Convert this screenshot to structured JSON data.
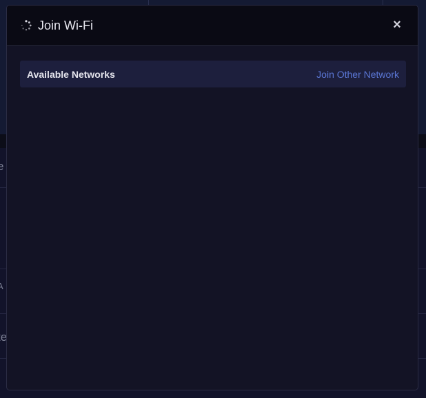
{
  "background": {
    "fragments": [
      "e",
      "A",
      "te"
    ]
  },
  "dialog": {
    "title": "Join Wi-Fi",
    "close_label": "×",
    "networks": {
      "header_label": "Available Networks",
      "join_other_label": "Join Other Network"
    }
  },
  "colors": {
    "dialog_bg": "#131325",
    "header_bg": "#0a0a14",
    "bar_bg": "#1d1f3d",
    "link": "#5b77d6"
  },
  "icons": {
    "spinner": "loading-spinner-icon",
    "close": "close-icon"
  }
}
